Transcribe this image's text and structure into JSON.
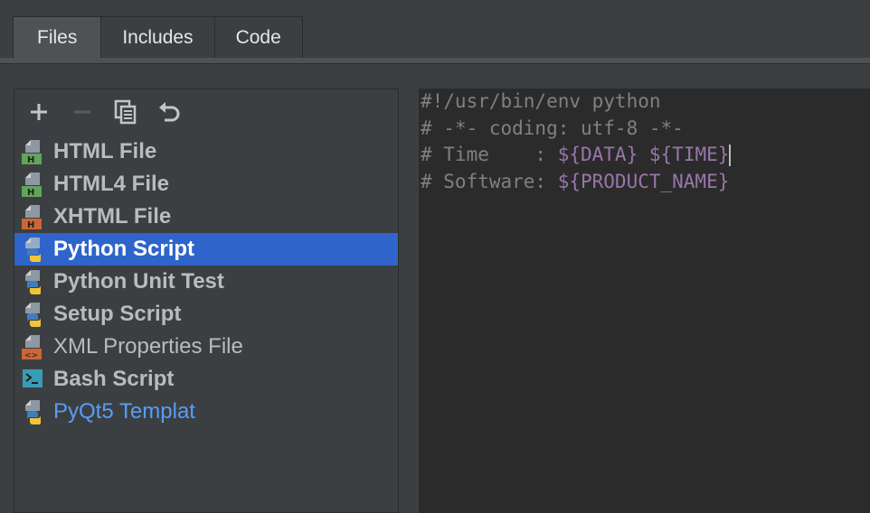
{
  "tabs": [
    {
      "label": "Files",
      "selected": true
    },
    {
      "label": "Includes",
      "selected": false
    },
    {
      "label": "Code",
      "selected": false
    }
  ],
  "toolbar": {
    "icons": [
      "plus-icon",
      "minus-icon",
      "copy-icon",
      "reset-icon"
    ]
  },
  "templates": [
    {
      "label": "HTML File",
      "icon": "html-file-icon"
    },
    {
      "label": "HTML4 File",
      "icon": "html-file-icon"
    },
    {
      "label": "XHTML File",
      "icon": "xhtml-file-icon"
    },
    {
      "label": "Python Script",
      "icon": "python-file-icon",
      "selected": true
    },
    {
      "label": "Python Unit Test",
      "icon": "python-file-icon"
    },
    {
      "label": "Setup Script",
      "icon": "python-file-icon"
    },
    {
      "label": "XML Properties File",
      "icon": "xml-file-icon"
    },
    {
      "label": "Bash Script",
      "icon": "bash-file-icon"
    },
    {
      "label": "PyQt5 Templat",
      "icon": "python-file-icon"
    }
  ],
  "editor": {
    "line1": "#!/usr/bin/env python",
    "line2": "# -*- coding: utf-8 -*-",
    "line3_prefix": "# Time    : ",
    "line3_var1": "${DATA}",
    "line3_sep": " ",
    "line3_var2": "${TIME}",
    "line4_prefix": "# Software: ",
    "line4_var": "${PRODUCT_NAME}"
  },
  "colors": {
    "selection": "#2f65ca",
    "variable": "#9876aa",
    "comment": "#808080",
    "link_blue": "#589df6"
  }
}
